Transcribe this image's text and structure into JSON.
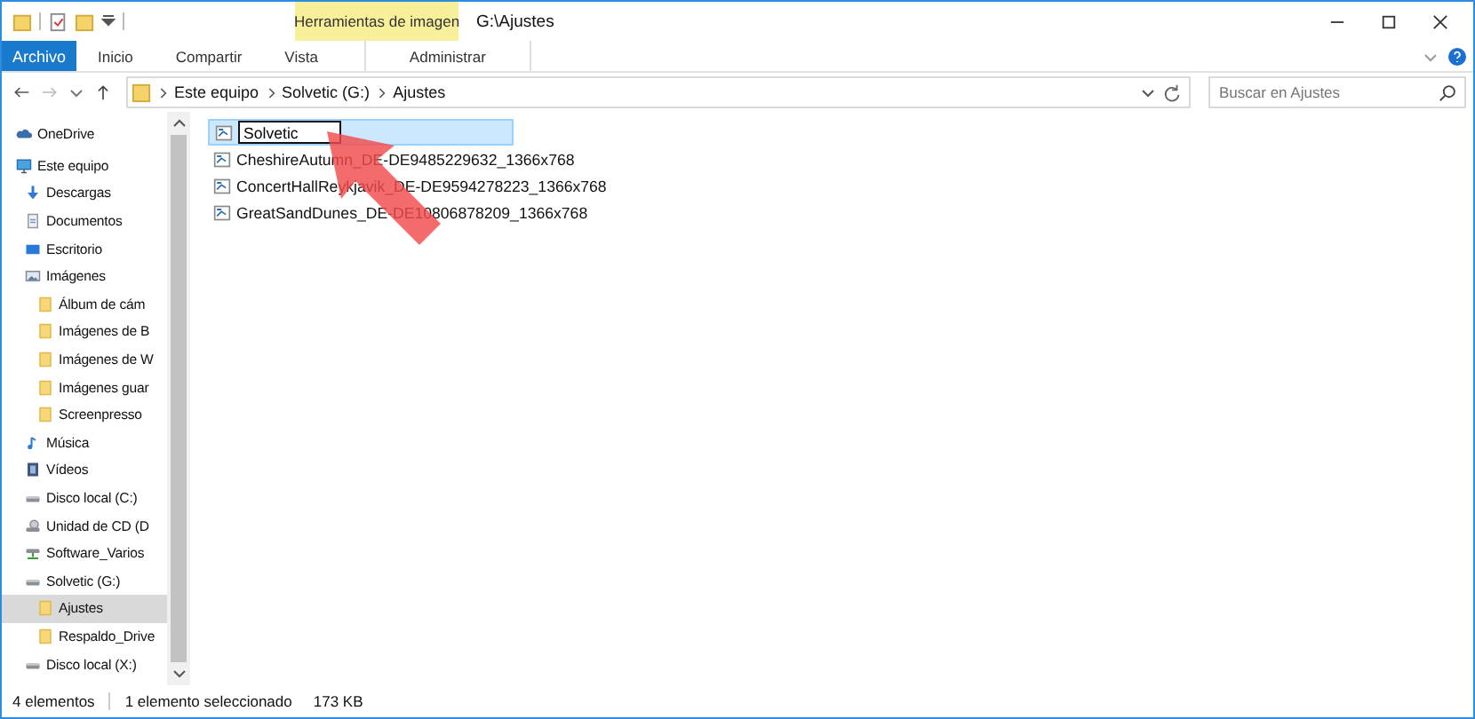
{
  "window": {
    "title": "G:\\Ajustes"
  },
  "ribbon": {
    "file_tab": "Archivo",
    "tabs": [
      "Inicio",
      "Compartir",
      "Vista"
    ],
    "context_group": {
      "title": "Herramientas de imagen",
      "tabs": [
        "Administrar"
      ]
    }
  },
  "address_bar": {
    "path": [
      "Este equipo",
      "Solvetic (G:)",
      "Ajustes"
    ]
  },
  "search": {
    "placeholder": "Buscar en Ajustes"
  },
  "sidebar": {
    "items": [
      {
        "label": "OneDrive",
        "kind": "cloud",
        "selected": false
      },
      {
        "label": "Este equipo",
        "kind": "pc",
        "selected": false,
        "children": [
          {
            "label": "Descargas",
            "kind": "download",
            "selected": false
          },
          {
            "label": "Documentos",
            "kind": "doc",
            "selected": false
          },
          {
            "label": "Escritorio",
            "kind": "desktop",
            "selected": false
          },
          {
            "label": "Imágenes",
            "kind": "images",
            "selected": false,
            "children": [
              {
                "label": "Álbum de cám",
                "kind": "folder",
                "selected": false
              },
              {
                "label": "Imágenes de B",
                "kind": "folder",
                "selected": false
              },
              {
                "label": "Imágenes de W",
                "kind": "folder",
                "selected": false
              },
              {
                "label": "Imágenes guar",
                "kind": "folder",
                "selected": false
              },
              {
                "label": "Screenpresso",
                "kind": "folder",
                "selected": false
              }
            ]
          },
          {
            "label": "Música",
            "kind": "music",
            "selected": false
          },
          {
            "label": "Vídeos",
            "kind": "video",
            "selected": false
          },
          {
            "label": "Disco local (C:)",
            "kind": "drive",
            "selected": false
          },
          {
            "label": "Unidad de CD (D",
            "kind": "cd",
            "selected": false
          },
          {
            "label": "Software_Varios",
            "kind": "netdrive",
            "selected": false
          },
          {
            "label": "Solvetic (G:)",
            "kind": "drive",
            "selected": false,
            "children": [
              {
                "label": "Ajustes",
                "kind": "folder",
                "selected": true
              },
              {
                "label": "Respaldo_Drive",
                "kind": "folder",
                "selected": false
              }
            ]
          },
          {
            "label": "Disco local (X:)",
            "kind": "drive",
            "selected": false
          }
        ]
      }
    ]
  },
  "files": [
    {
      "name": "Solvetic",
      "selected": true,
      "editing": true
    },
    {
      "name": "CheshireAutumn_DE-DE9485229632_1366x768",
      "selected": false,
      "editing": false
    },
    {
      "name": "ConcertHallReykjavik_DE-DE9594278223_1366x768",
      "selected": false,
      "editing": false
    },
    {
      "name": "GreatSandDunes_DE-DE10806878209_1366x768",
      "selected": false,
      "editing": false
    }
  ],
  "status_bar": {
    "count": "4 elementos",
    "selection": "1 elemento seleccionado",
    "size": "173 KB"
  }
}
